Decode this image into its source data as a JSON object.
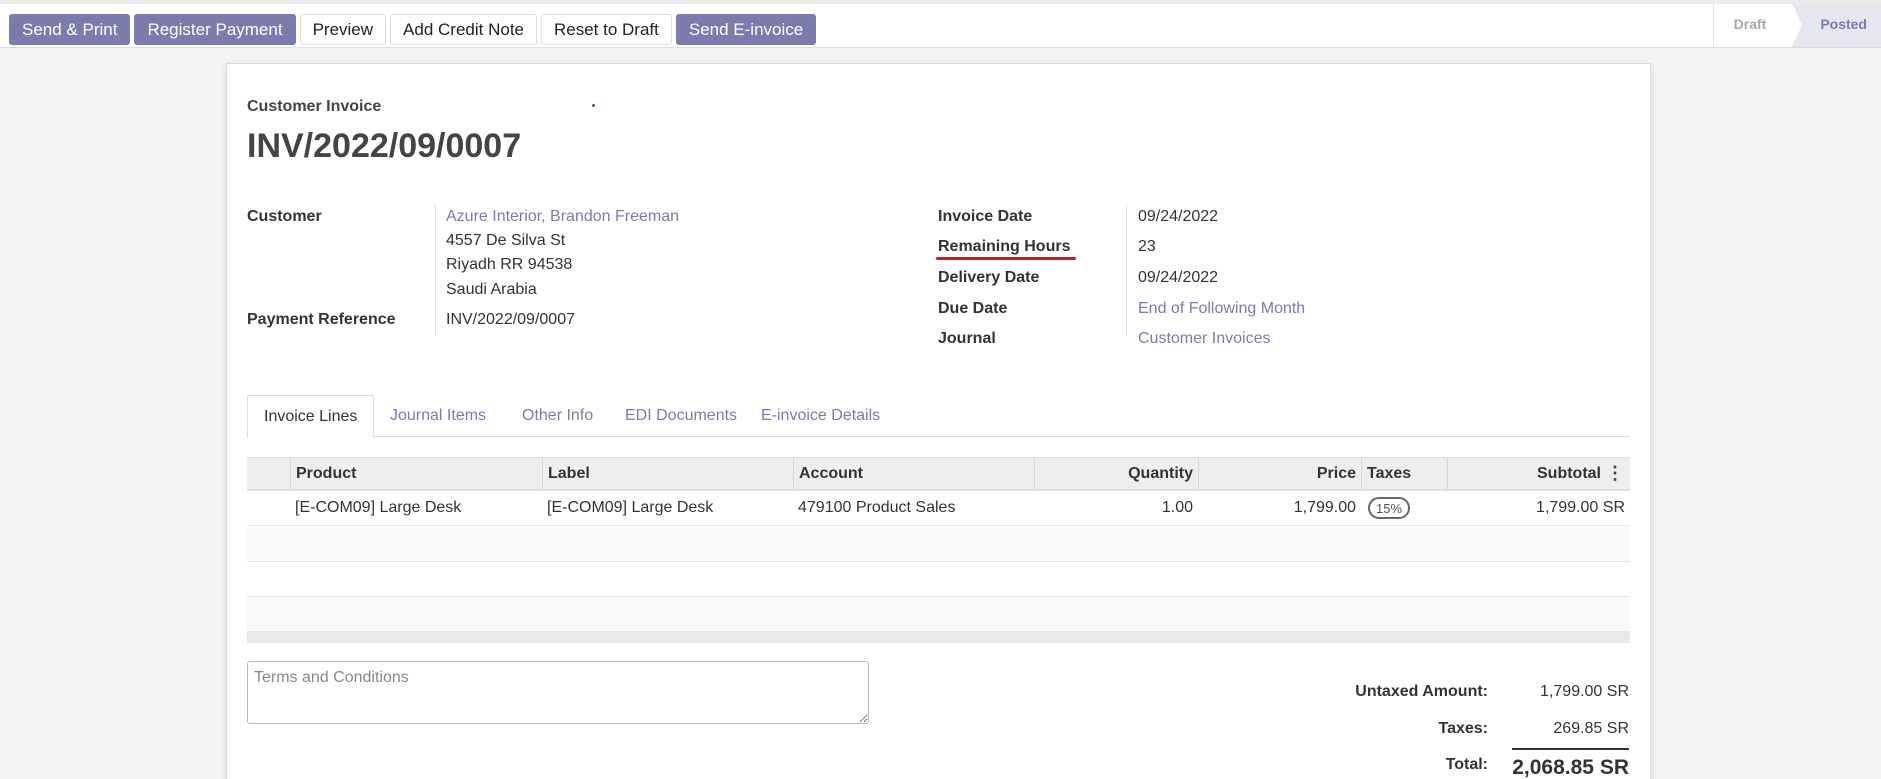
{
  "toolbar": {
    "buttons": [
      "Send & Print",
      "Register Payment",
      "Preview",
      "Add Credit Note",
      "Reset to Draft",
      "Send E-invoice"
    ]
  },
  "statusbar": {
    "draft": "Draft",
    "posted": "Posted",
    "active": "Posted"
  },
  "invoice": {
    "kind": "Customer Invoice",
    "number": "INV/2022/09/0007"
  },
  "left_fields": {
    "customer_label": "Customer",
    "customer_name": "Azure Interior, Brandon Freeman",
    "address_line1": "4557 De Silva St",
    "address_line2": "Riyadh RR 94538",
    "address_line3": "Saudi Arabia",
    "payment_ref_label": "Payment Reference",
    "payment_ref_value": "INV/2022/09/0007"
  },
  "right_fields": {
    "invoice_date_label": "Invoice Date",
    "invoice_date_value": "09/24/2022",
    "remaining_hours_label": "Remaining Hours",
    "remaining_hours_value": "23",
    "delivery_date_label": "Delivery Date",
    "delivery_date_value": "09/24/2022",
    "due_date_label": "Due Date",
    "due_date_value": "End of Following Month",
    "journal_label": "Journal",
    "journal_value": "Customer Invoices"
  },
  "tabs": [
    "Invoice Lines",
    "Journal Items",
    "Other Info",
    "EDI Documents",
    "E-invoice Details"
  ],
  "table": {
    "columns": [
      "Product",
      "Label",
      "Account",
      "Quantity",
      "Price",
      "Taxes",
      "Subtotal"
    ],
    "rows": [
      {
        "product": "[E-COM09] Large Desk",
        "label": "[E-COM09] Large Desk",
        "account": "479100 Product Sales",
        "quantity": "1.00",
        "price": "1,799.00",
        "taxes": "15%",
        "subtotal": "1,799.00 SR"
      }
    ]
  },
  "terms": {
    "placeholder": "Terms and Conditions"
  },
  "totals": {
    "untaxed_label": "Untaxed Amount:",
    "untaxed_value": "1,799.00 SR",
    "taxes_label": "Taxes:",
    "taxes_value": "269.85 SR",
    "total_label": "Total:",
    "total_value": "2,068.85 SR"
  },
  "colors": {
    "accent": "#7c7bad",
    "underline": "#e21212"
  }
}
